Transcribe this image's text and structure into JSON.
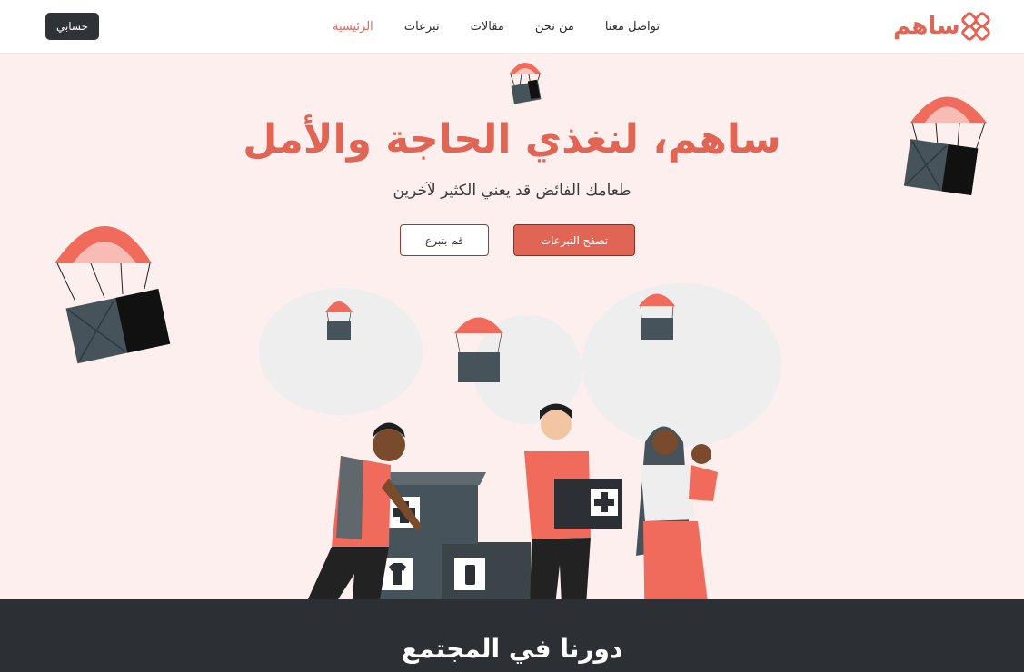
{
  "header": {
    "logo_text": "ساهم",
    "account_label": "حسابي",
    "nav": [
      {
        "label": "الرئيسية",
        "active": true
      },
      {
        "label": "تبرعات",
        "active": false
      },
      {
        "label": "مقالات",
        "active": false
      },
      {
        "label": "من نحن",
        "active": false
      },
      {
        "label": "تواصل معنا",
        "active": false
      }
    ]
  },
  "hero": {
    "title": "ساهم، لنغذي الحاجة والأمل",
    "subtitle": "طعامك الفائض قد يعني الكثير لآخرين",
    "primary_button": "تصفح التبرعات",
    "secondary_button": "قم بتبرع"
  },
  "section": {
    "title": "دورنا في المجتمع"
  },
  "colors": {
    "accent": "#e06555",
    "hero_bg": "#fcefed",
    "dark": "#2c3034",
    "box": "#46535a"
  },
  "icons": [
    "logo-mark-icon",
    "parachute-icon",
    "medical-cross-icon",
    "tshirt-icon",
    "bottle-icon"
  ]
}
